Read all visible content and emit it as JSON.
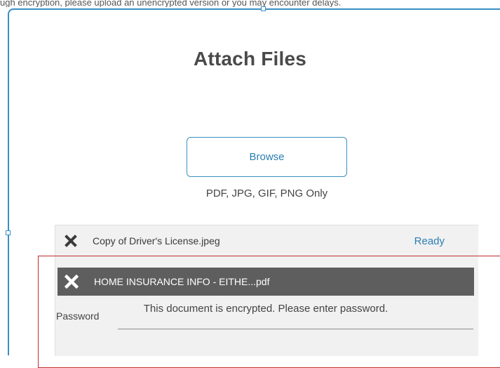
{
  "top_fragment": "ugh encryption, please upload an unencrypted version or you may encounter delays.",
  "dialog": {
    "title": "Attach Files",
    "browse_label": "Browse",
    "file_types_hint": "PDF, JPG, GIF, PNG Only"
  },
  "files": [
    {
      "name": "Copy of Driver's License.jpeg",
      "status": "Ready",
      "remove_icon": "close-icon"
    },
    {
      "name": "HOME INSURANCE INFO - EITHE...pdf",
      "status": "",
      "remove_icon": "close-icon"
    }
  ],
  "encrypted": {
    "message": "This document is encrypted. Please enter password.",
    "password_label": "Password",
    "password_value": ""
  },
  "colors": {
    "accent": "#2b7fb3",
    "frame": "#3a8fc4",
    "dark_row": "#5e5e5e",
    "selection": "#c22b2b"
  }
}
